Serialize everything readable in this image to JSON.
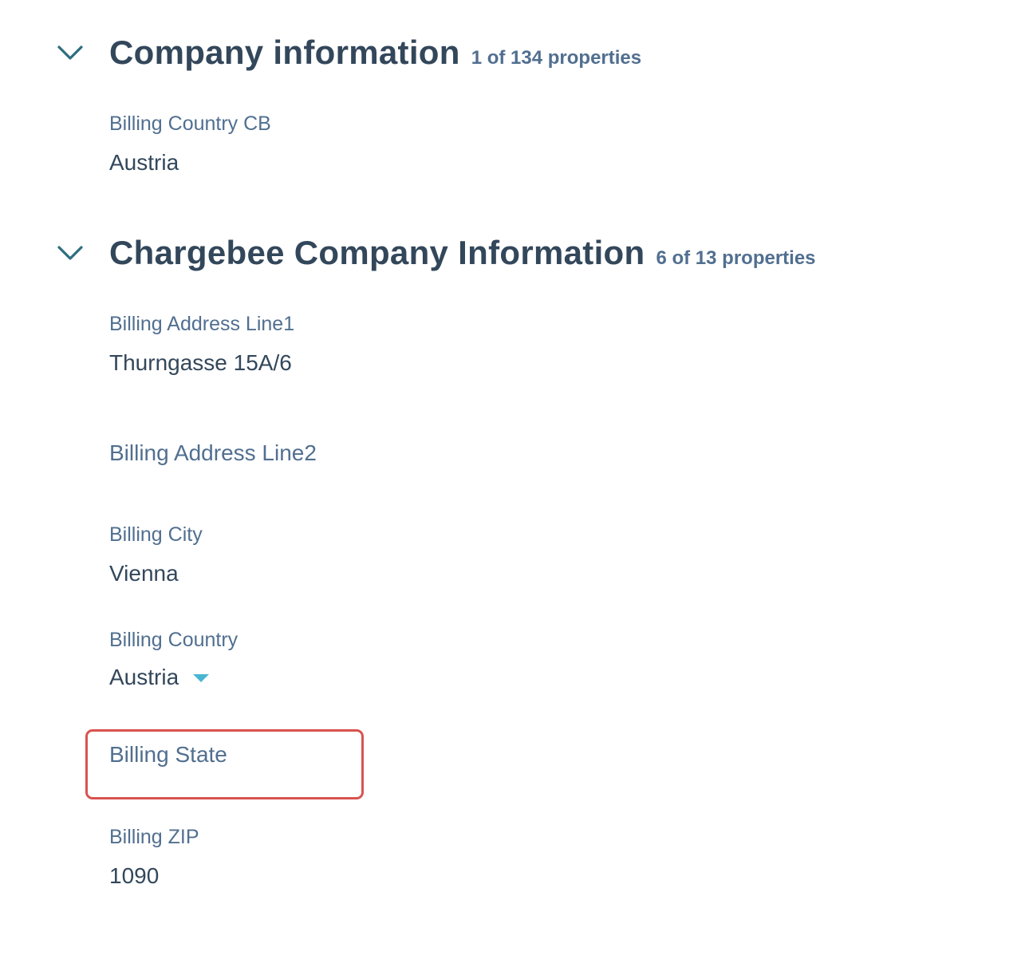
{
  "sections": [
    {
      "title": "Company information",
      "count": "1 of 134 properties",
      "properties": [
        {
          "label": "Billing Country CB",
          "value": "Austria"
        }
      ]
    },
    {
      "title": "Chargebee Company Information",
      "count": "6 of 13 properties",
      "properties": [
        {
          "label": "Billing Address Line1",
          "value": "Thurngasse 15A/6"
        },
        {
          "label": "Billing Address Line2",
          "value": ""
        },
        {
          "label": "Billing City",
          "value": "Vienna"
        },
        {
          "label": "Billing Country",
          "value": "Austria"
        },
        {
          "label": "Billing State",
          "value": ""
        },
        {
          "label": "Billing ZIP",
          "value": "1090"
        }
      ]
    }
  ],
  "icons": {
    "collapse": "chevron-down-icon",
    "dropdown": "caret-down-icon"
  },
  "colors": {
    "chevron": "#2d6e7e",
    "heading": "#33475b",
    "label": "#516f90",
    "caret": "#49b6d1",
    "highlight": "#d9534f"
  }
}
